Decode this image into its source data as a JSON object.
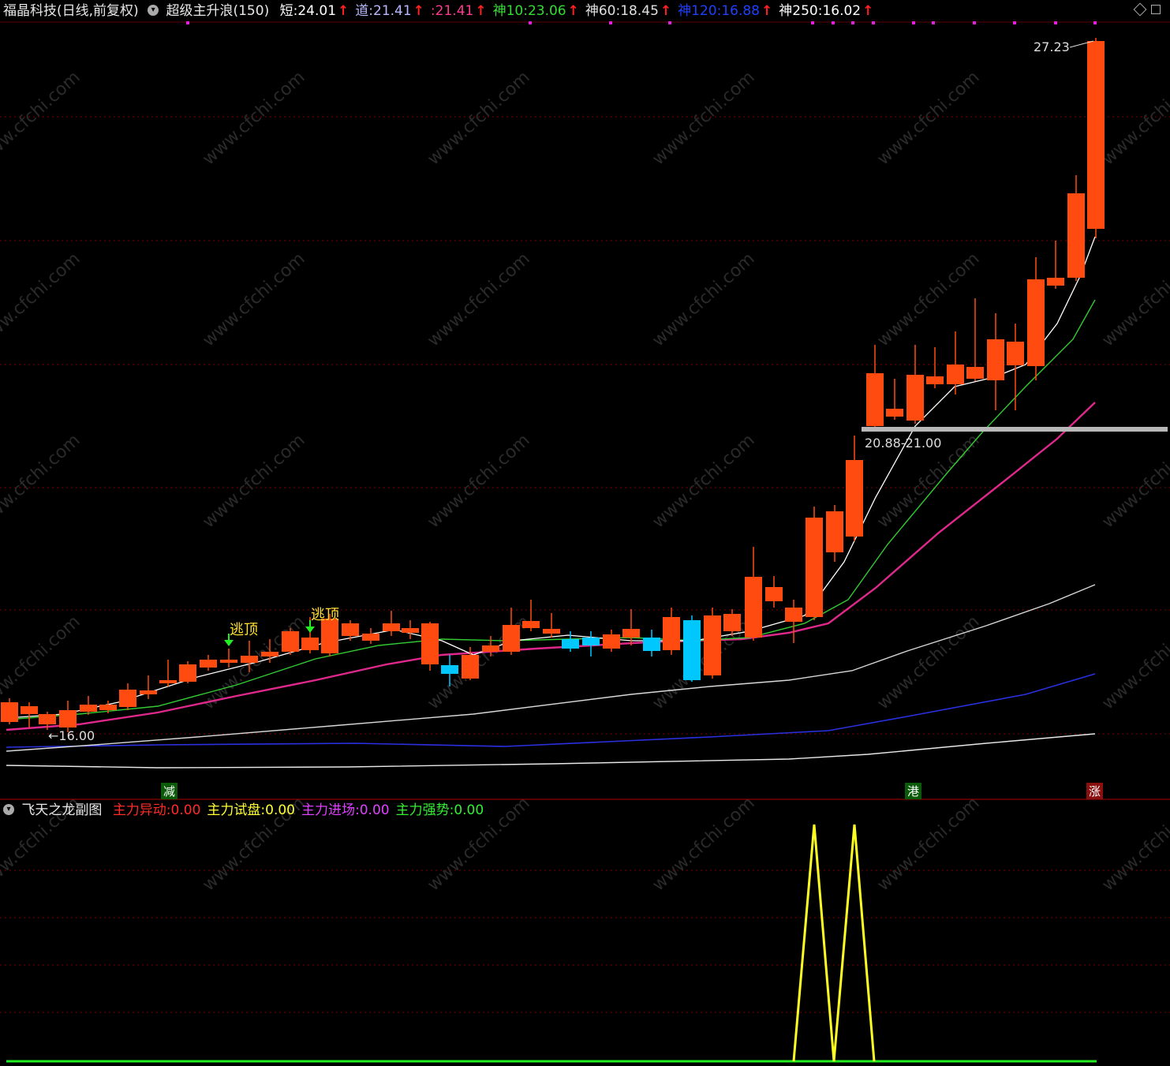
{
  "main_header": {
    "stock_name": "福晶科技(日线,前复权)",
    "indicator_name": "超级主升浪(150)",
    "items": [
      {
        "label": "短:",
        "value": "24.01",
        "color": "#ffffff"
      },
      {
        "label": "道:",
        "value": "21.41",
        "color": "#b8b8ff"
      },
      {
        "label": ":",
        "value": "21.41",
        "color": "#ff3a8c"
      },
      {
        "label": "神10:",
        "value": "23.06",
        "color": "#33dd33"
      },
      {
        "label": "神60:",
        "value": "18.45",
        "color": "#e0e0e0"
      },
      {
        "label": "神120:",
        "value": "16.88",
        "color": "#2040ff"
      },
      {
        "label": "神250:",
        "value": "16.02",
        "color": "#ffffff"
      }
    ]
  },
  "sub_header": {
    "indicator_name": "飞天之龙副图",
    "items": [
      {
        "label": "主力异动:",
        "value": "0.00",
        "color": "#ff2a2a"
      },
      {
        "label": "主力试盘:",
        "value": "0.00",
        "color": "#ffff33"
      },
      {
        "label": "主力进场:",
        "value": "0.00",
        "color": "#e040ff"
      },
      {
        "label": "主力强势:",
        "value": "0.00",
        "color": "#33ee33"
      }
    ]
  },
  "annotations": {
    "high_label": "27.23",
    "low_label": "←16.00",
    "range_label": "20.88-21.00",
    "escape_top_1": "逃顶",
    "escape_top_2": "逃顶"
  },
  "bottom_tags": [
    {
      "text": "减",
      "color": "#33cc33"
    },
    {
      "text": "港",
      "color": "#33cc33"
    },
    {
      "text": "涨",
      "color": "#ff3333"
    }
  ],
  "watermark": "www.cfchi.com",
  "colors": {
    "bull": "#ff4a10",
    "bear": "#00c8ff",
    "grid": "#7a0000"
  }
}
